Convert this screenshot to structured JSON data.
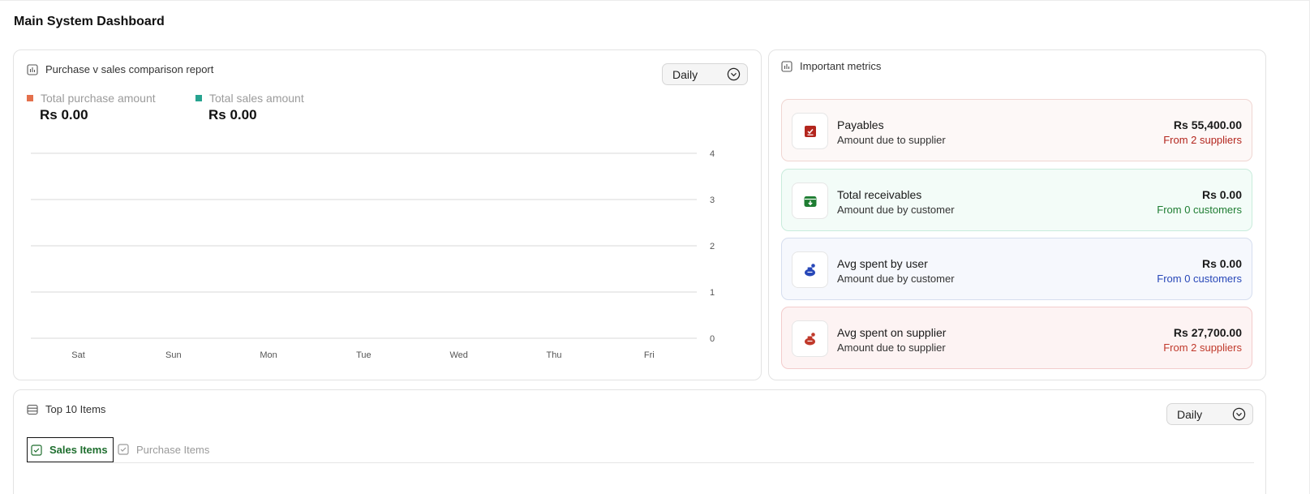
{
  "page": {
    "title": "Main System Dashboard"
  },
  "comparison": {
    "title": "Purchase v sales comparison report",
    "period": "Daily",
    "legend": [
      {
        "label": "Total purchase amount",
        "value": "Rs 0.00",
        "color": "#e4704c"
      },
      {
        "label": "Total sales amount",
        "value": "Rs 0.00",
        "color": "#27a390"
      }
    ]
  },
  "chart_data": {
    "type": "line",
    "title": "",
    "categories": [
      "Sat",
      "Sun",
      "Mon",
      "Tue",
      "Wed",
      "Thu",
      "Fri"
    ],
    "series": [
      {
        "name": "Total purchase amount",
        "values": [
          0,
          0,
          0,
          0,
          0,
          0,
          0
        ]
      },
      {
        "name": "Total sales amount",
        "values": [
          0,
          0,
          0,
          0,
          0,
          0,
          0
        ]
      }
    ],
    "ylim": [
      0,
      4
    ],
    "yticks": [
      "0",
      "1",
      "2",
      "3",
      "4"
    ],
    "grid": true,
    "y_axis_side": "right",
    "xlabel": "",
    "ylabel": ""
  },
  "metrics": {
    "title": "Important metrics",
    "items": [
      {
        "title": "Payables",
        "subtitle": "Amount due to supplier",
        "value": "Rs 55,400.00",
        "from": "From 2 suppliers",
        "icon": "payables-icon",
        "accent": "#b3261e",
        "bg": "#fdf8f7",
        "border": "#f0d6d2"
      },
      {
        "title": "Total receivables",
        "subtitle": "Amount due by customer",
        "value": "Rs 0.00",
        "from": "From 0 customers",
        "icon": "receivables-icon",
        "accent": "#1e7d32",
        "bg": "#f3fcf8",
        "border": "#c9ecdc"
      },
      {
        "title": "Avg spent by user",
        "subtitle": "Amount due by customer",
        "value": "Rs 0.00",
        "from": "From 0 customers",
        "icon": "user-spend-icon",
        "accent": "#2747b8",
        "bg": "#f6f8fd",
        "border": "#d6deef"
      },
      {
        "title": "Avg spent on supplier",
        "subtitle": "Amount due to supplier",
        "value": "Rs 27,700.00",
        "from": "From 2 suppliers",
        "icon": "supplier-spend-icon",
        "accent": "#c0392b",
        "bg": "#fdf3f3",
        "border": "#f3cccc"
      }
    ]
  },
  "top_items": {
    "title": "Top 10 Items",
    "period": "Daily",
    "tabs": [
      {
        "label": "Sales Items",
        "active": true
      },
      {
        "label": "Purchase Items",
        "active": false
      }
    ]
  }
}
